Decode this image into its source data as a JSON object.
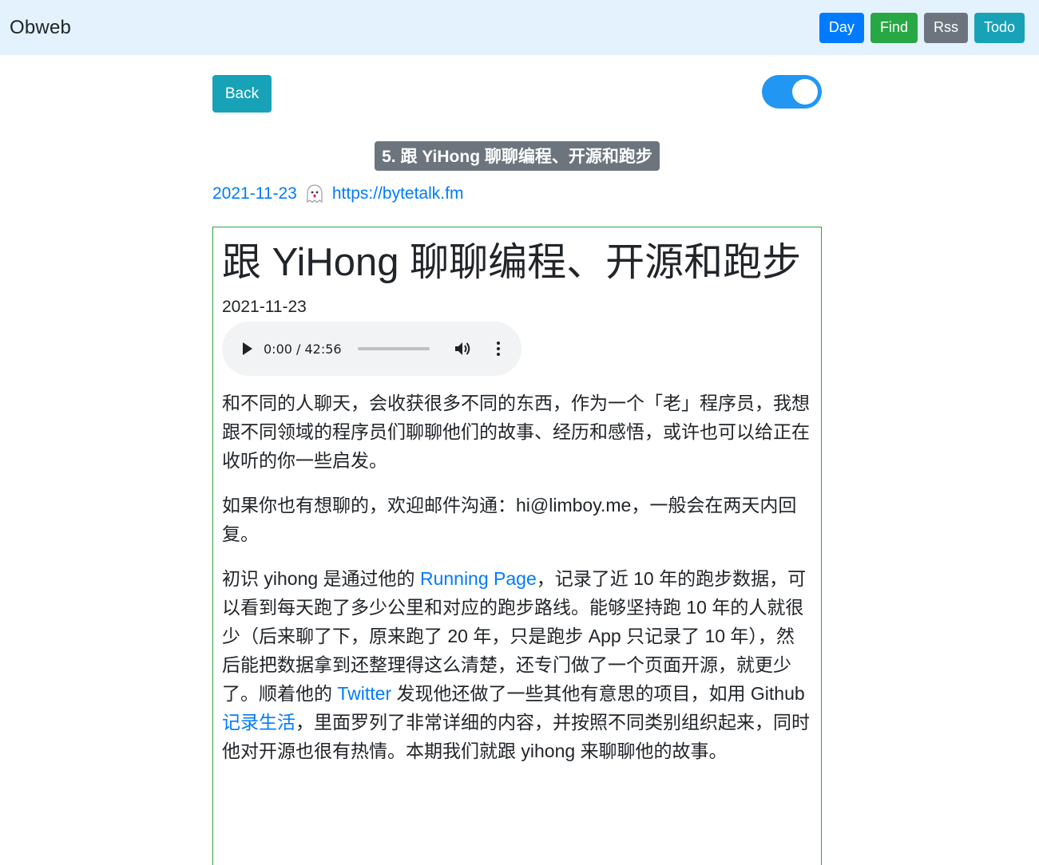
{
  "navbar": {
    "brand": "Obweb",
    "buttons": [
      {
        "label": "Day",
        "color": "#007bff"
      },
      {
        "label": "Find",
        "color": "#28a745"
      },
      {
        "label": "Rss",
        "color": "#6c757d"
      },
      {
        "label": "Todo",
        "color": "#17a2b8"
      }
    ]
  },
  "page": {
    "back_label": "Back",
    "toggle_on": true,
    "title": "5. 跟 YiHong 聊聊编程、开源和跑步",
    "date": "2021-11-23",
    "source_icon": "ghost-icon",
    "source_url": "https://bytetalk.fm"
  },
  "article": {
    "title": "跟 YiHong 聊聊编程、开源和跑步",
    "date": "2021-11-23",
    "player": {
      "time": "0:00 / 42:56"
    },
    "para1": "和不同的人聊天，会收获很多不同的东西，作为一个「老」程序员，我想跟不同领域的程序员们聊聊他们的故事、经历和感悟，或许也可以给正在收听的你一些启发。",
    "para2": "如果你也有想聊的，欢迎邮件沟通：hi@limboy.me，一般会在两天内回复。",
    "para3": {
      "t1": "初识 yihong 是通过他的 ",
      "link1": "Running Page",
      "t2": "，记录了近 10 年的跑步数据，可以看到每天跑了多少公里和对应的跑步路线。能够坚持跑 10 年的人就很少（后来聊了下，原来跑了 20 年，只是跑步 App 只记录了 10 年），然后能把数据拿到还整理得这么清楚，还专门做了一个页面开源，就更少了。顺着他的 ",
      "link2": "Twitter",
      "t3": " 发现他还做了一些其他有意思的项目，如用 Github ",
      "link3": "记录生活",
      "t4": "，里面罗列了非常详细的内容，并按照不同类别组织起来，同时他对开源也很有热情。本期我们就跟 yihong 来聊聊他的故事。"
    }
  }
}
